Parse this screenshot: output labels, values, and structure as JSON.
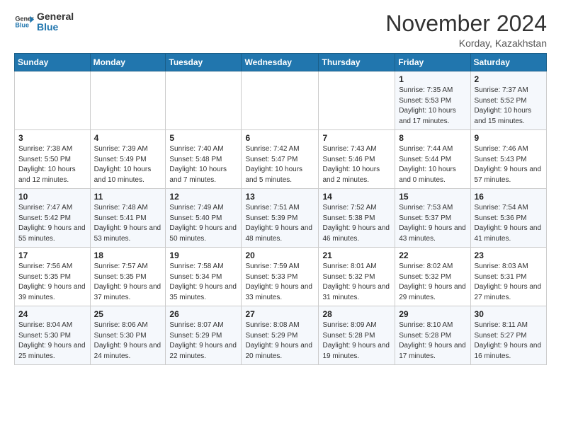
{
  "header": {
    "logo_line1": "General",
    "logo_line2": "Blue",
    "month": "November 2024",
    "location": "Korday, Kazakhstan"
  },
  "days_of_week": [
    "Sunday",
    "Monday",
    "Tuesday",
    "Wednesday",
    "Thursday",
    "Friday",
    "Saturday"
  ],
  "weeks": [
    [
      {
        "day": "",
        "info": ""
      },
      {
        "day": "",
        "info": ""
      },
      {
        "day": "",
        "info": ""
      },
      {
        "day": "",
        "info": ""
      },
      {
        "day": "",
        "info": ""
      },
      {
        "day": "1",
        "info": "Sunrise: 7:35 AM\nSunset: 5:53 PM\nDaylight: 10 hours and 17 minutes."
      },
      {
        "day": "2",
        "info": "Sunrise: 7:37 AM\nSunset: 5:52 PM\nDaylight: 10 hours and 15 minutes."
      }
    ],
    [
      {
        "day": "3",
        "info": "Sunrise: 7:38 AM\nSunset: 5:50 PM\nDaylight: 10 hours and 12 minutes."
      },
      {
        "day": "4",
        "info": "Sunrise: 7:39 AM\nSunset: 5:49 PM\nDaylight: 10 hours and 10 minutes."
      },
      {
        "day": "5",
        "info": "Sunrise: 7:40 AM\nSunset: 5:48 PM\nDaylight: 10 hours and 7 minutes."
      },
      {
        "day": "6",
        "info": "Sunrise: 7:42 AM\nSunset: 5:47 PM\nDaylight: 10 hours and 5 minutes."
      },
      {
        "day": "7",
        "info": "Sunrise: 7:43 AM\nSunset: 5:46 PM\nDaylight: 10 hours and 2 minutes."
      },
      {
        "day": "8",
        "info": "Sunrise: 7:44 AM\nSunset: 5:44 PM\nDaylight: 10 hours and 0 minutes."
      },
      {
        "day": "9",
        "info": "Sunrise: 7:46 AM\nSunset: 5:43 PM\nDaylight: 9 hours and 57 minutes."
      }
    ],
    [
      {
        "day": "10",
        "info": "Sunrise: 7:47 AM\nSunset: 5:42 PM\nDaylight: 9 hours and 55 minutes."
      },
      {
        "day": "11",
        "info": "Sunrise: 7:48 AM\nSunset: 5:41 PM\nDaylight: 9 hours and 53 minutes."
      },
      {
        "day": "12",
        "info": "Sunrise: 7:49 AM\nSunset: 5:40 PM\nDaylight: 9 hours and 50 minutes."
      },
      {
        "day": "13",
        "info": "Sunrise: 7:51 AM\nSunset: 5:39 PM\nDaylight: 9 hours and 48 minutes."
      },
      {
        "day": "14",
        "info": "Sunrise: 7:52 AM\nSunset: 5:38 PM\nDaylight: 9 hours and 46 minutes."
      },
      {
        "day": "15",
        "info": "Sunrise: 7:53 AM\nSunset: 5:37 PM\nDaylight: 9 hours and 43 minutes."
      },
      {
        "day": "16",
        "info": "Sunrise: 7:54 AM\nSunset: 5:36 PM\nDaylight: 9 hours and 41 minutes."
      }
    ],
    [
      {
        "day": "17",
        "info": "Sunrise: 7:56 AM\nSunset: 5:35 PM\nDaylight: 9 hours and 39 minutes."
      },
      {
        "day": "18",
        "info": "Sunrise: 7:57 AM\nSunset: 5:35 PM\nDaylight: 9 hours and 37 minutes."
      },
      {
        "day": "19",
        "info": "Sunrise: 7:58 AM\nSunset: 5:34 PM\nDaylight: 9 hours and 35 minutes."
      },
      {
        "day": "20",
        "info": "Sunrise: 7:59 AM\nSunset: 5:33 PM\nDaylight: 9 hours and 33 minutes."
      },
      {
        "day": "21",
        "info": "Sunrise: 8:01 AM\nSunset: 5:32 PM\nDaylight: 9 hours and 31 minutes."
      },
      {
        "day": "22",
        "info": "Sunrise: 8:02 AM\nSunset: 5:32 PM\nDaylight: 9 hours and 29 minutes."
      },
      {
        "day": "23",
        "info": "Sunrise: 8:03 AM\nSunset: 5:31 PM\nDaylight: 9 hours and 27 minutes."
      }
    ],
    [
      {
        "day": "24",
        "info": "Sunrise: 8:04 AM\nSunset: 5:30 PM\nDaylight: 9 hours and 25 minutes."
      },
      {
        "day": "25",
        "info": "Sunrise: 8:06 AM\nSunset: 5:30 PM\nDaylight: 9 hours and 24 minutes."
      },
      {
        "day": "26",
        "info": "Sunrise: 8:07 AM\nSunset: 5:29 PM\nDaylight: 9 hours and 22 minutes."
      },
      {
        "day": "27",
        "info": "Sunrise: 8:08 AM\nSunset: 5:29 PM\nDaylight: 9 hours and 20 minutes."
      },
      {
        "day": "28",
        "info": "Sunrise: 8:09 AM\nSunset: 5:28 PM\nDaylight: 9 hours and 19 minutes."
      },
      {
        "day": "29",
        "info": "Sunrise: 8:10 AM\nSunset: 5:28 PM\nDaylight: 9 hours and 17 minutes."
      },
      {
        "day": "30",
        "info": "Sunrise: 8:11 AM\nSunset: 5:27 PM\nDaylight: 9 hours and 16 minutes."
      }
    ]
  ]
}
